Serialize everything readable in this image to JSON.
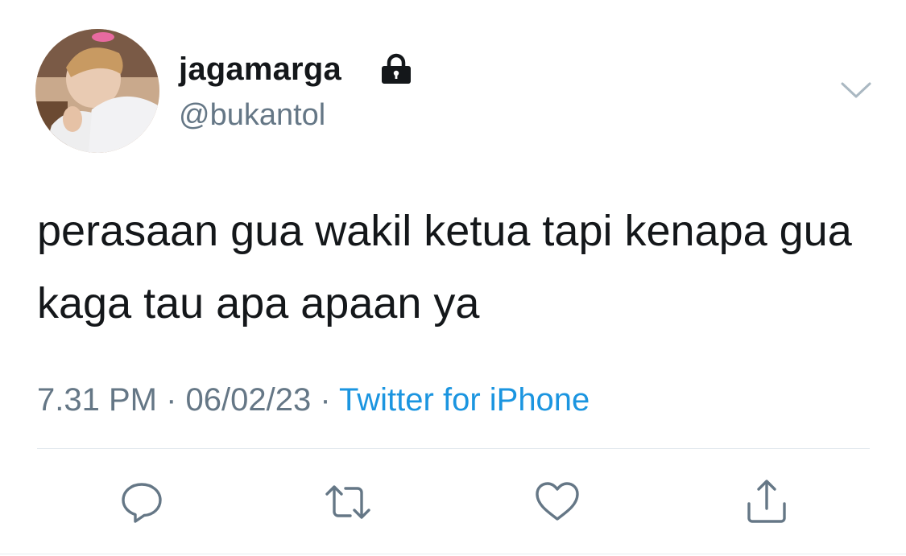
{
  "user": {
    "display_name": "jagamarga",
    "handle": "@bukantol",
    "protected": true
  },
  "tweet": {
    "text": "perasaan gua wakil ketua tapi kenapa gua kaga tau apa apaan ya",
    "time": "7.31 PM",
    "separator": " · ",
    "date": "06/02/23",
    "source": "Twitter for iPhone"
  },
  "actions": [
    {
      "name": "reply",
      "icon": "speech-bubble-icon"
    },
    {
      "name": "retweet",
      "icon": "retweet-icon"
    },
    {
      "name": "like",
      "icon": "heart-icon"
    },
    {
      "name": "share",
      "icon": "share-icon"
    }
  ],
  "colors": {
    "text": "#14171a",
    "secondary": "#657786",
    "link": "#1b95e0",
    "divider": "#e1e8ed"
  }
}
